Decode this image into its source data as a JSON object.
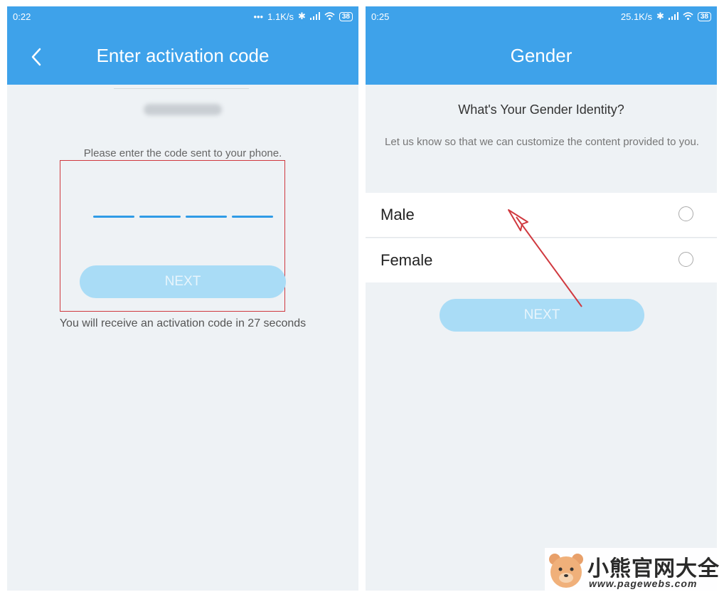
{
  "left_screen": {
    "status": {
      "time": "0:22",
      "dots": "•••",
      "speed": "1.1K/s",
      "battery": "38"
    },
    "title": "Enter activation code",
    "instruction": "Please enter the code sent to your phone.",
    "next_label": "NEXT",
    "countdown": "You will receive an activation code in 27 seconds"
  },
  "right_screen": {
    "status": {
      "time": "0:25",
      "speed": "25.1K/s",
      "battery": "38"
    },
    "title": "Gender",
    "question": "What's Your Gender Identity?",
    "subtext": "Let us know so that we can customize the content provided to you.",
    "options": [
      {
        "label": "Male"
      },
      {
        "label": "Female"
      }
    ],
    "next_label": "NEXT"
  },
  "watermark": {
    "name": "小熊官网大全",
    "url": "www.pagewebs.com"
  },
  "colors": {
    "accent": "#3ea2ea",
    "button_disabled": "#a9dcf6",
    "highlight": "#d0393f",
    "arrow": "#d0393f"
  }
}
